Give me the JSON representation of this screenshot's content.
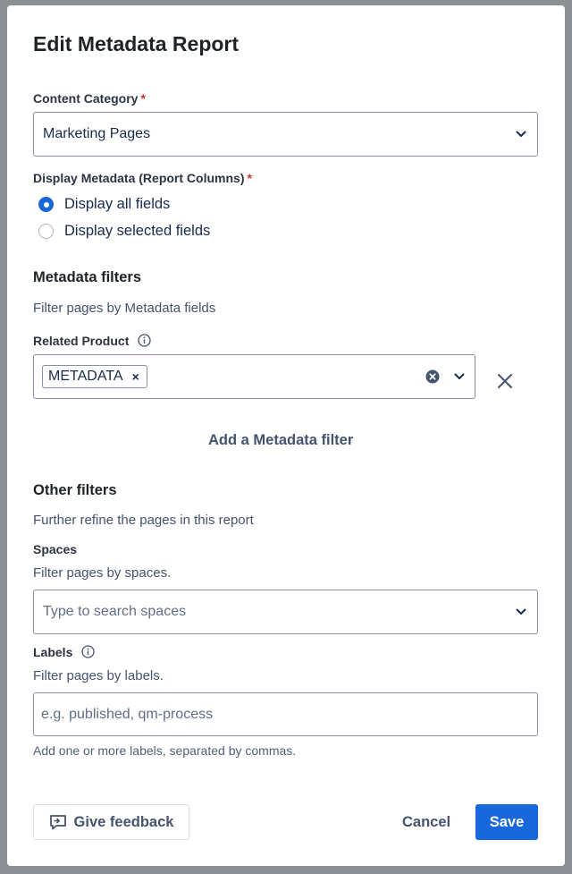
{
  "dialog": {
    "title": "Edit Metadata Report"
  },
  "content_category": {
    "label": "Content Category",
    "required_marker": "*",
    "value": "Marketing Pages"
  },
  "display_metadata": {
    "label": "Display Metadata (Report Columns)",
    "required_marker": "*",
    "options": [
      {
        "label": "Display all fields",
        "selected": true
      },
      {
        "label": "Display selected fields",
        "selected": false
      }
    ]
  },
  "metadata_filters": {
    "heading": "Metadata filters",
    "description": "Filter pages by Metadata fields",
    "filter": {
      "label": "Related Product",
      "tags": [
        "METADATA"
      ]
    },
    "add_label": "Add a Metadata filter"
  },
  "other_filters": {
    "heading": "Other filters",
    "description": "Further refine the pages in this report",
    "spaces": {
      "label": "Spaces",
      "description": "Filter pages by spaces.",
      "placeholder": "Type to search spaces"
    },
    "labels": {
      "label": "Labels",
      "description": "Filter pages by labels.",
      "placeholder": "e.g. published, qm-process",
      "hint": "Add one or more labels, separated by commas."
    }
  },
  "footer": {
    "feedback_label": "Give feedback",
    "cancel_label": "Cancel",
    "save_label": "Save"
  },
  "colors": {
    "primary": "#1868db",
    "required": "#c9372c",
    "backdrop": "#8c8f94"
  }
}
